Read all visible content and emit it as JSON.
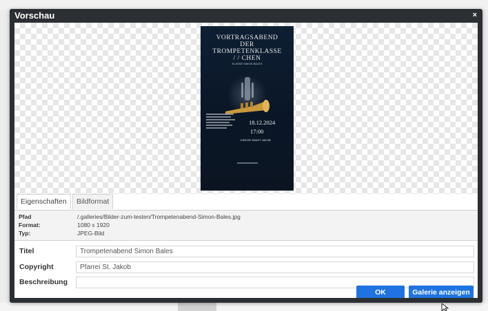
{
  "dialog": {
    "title": "Vorschau",
    "close_label": "×"
  },
  "poster": {
    "title_lines": [
      "VORTRAGSABEND",
      "DER",
      "TROMPETENKLASSE",
      "/ / CHEN"
    ],
    "subtitle": "KLASSE SIMON BALES",
    "date": "18.12.2024",
    "time": "17:00",
    "place": "KIRCHE SANKT JAKOB"
  },
  "tabs": [
    {
      "label": "Eigenschaften",
      "active": true
    },
    {
      "label": "Bildformat",
      "active": false
    }
  ],
  "info": {
    "path_label": "Pfad",
    "path_value": "/.galleries/Bilder-zum-testen/Trompetenabend-Simon-Bales.jpg",
    "format_label": "Format:",
    "format_value": "1080 x 1920",
    "type_label": "Typ:",
    "type_value": "JPEG-Bild"
  },
  "fields": {
    "title_label": "Titel",
    "title_value": "Trompetenabend Simon Bales",
    "copyright_label": "Copyright",
    "copyright_value": "Pfarrei St. Jakob",
    "description_label": "Beschreibung",
    "description_value": ""
  },
  "buttons": {
    "ok": "OK",
    "gallery": "Galerie anzeigen"
  },
  "colors": {
    "dialog_bg": "#2b2f33",
    "primary_button": "#1f73e0"
  }
}
